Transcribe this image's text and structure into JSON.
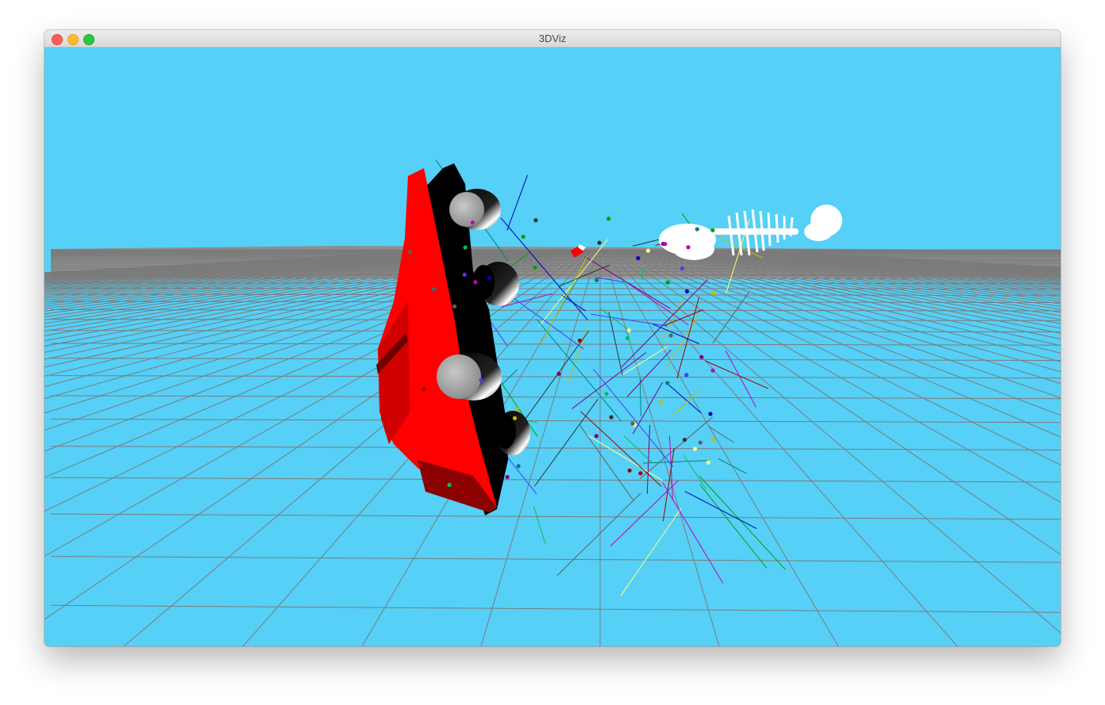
{
  "window": {
    "title": "3DViz"
  },
  "scene": {
    "sky_color": "#56d0f6",
    "ground_color": "#8e8e8e",
    "grid_color": "#7b7b7b",
    "objects": [
      "car",
      "toy-car",
      "skeleton",
      "particle-lines",
      "particle-spheres"
    ],
    "car_body_color": "#ff0000",
    "car_shell_color": "#000000",
    "car_wheel_color": "#a9a9a9",
    "skeleton_color": "#ffffff"
  }
}
